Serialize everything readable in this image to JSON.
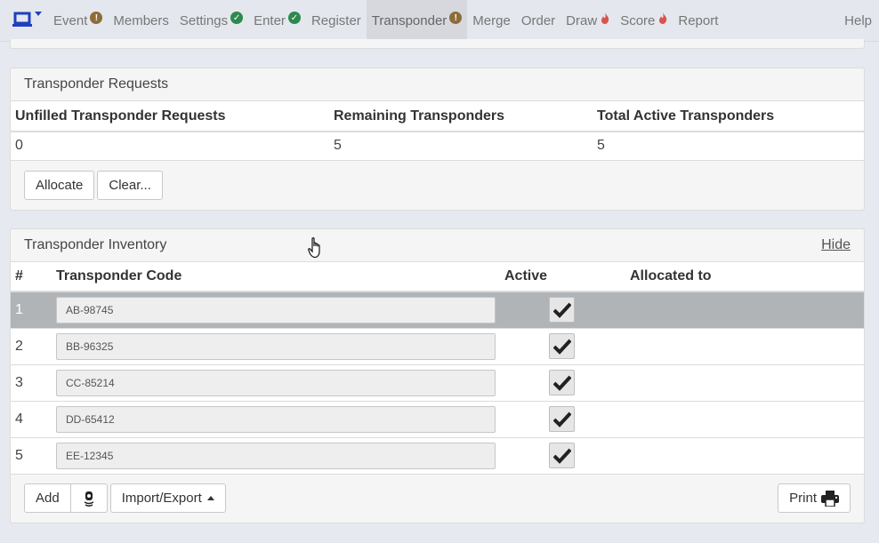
{
  "nav": {
    "brand_icon": "laptop-icon",
    "items": [
      {
        "label": "Event",
        "status": "warn"
      },
      {
        "label": "Members",
        "status": ""
      },
      {
        "label": "Settings",
        "status": "ok"
      },
      {
        "label": "Enter",
        "status": "ok"
      },
      {
        "label": "Register",
        "status": ""
      },
      {
        "label": "Transponder",
        "status": "warn",
        "active": true
      },
      {
        "label": "Merge",
        "status": ""
      },
      {
        "label": "Order",
        "status": ""
      },
      {
        "label": "Draw",
        "status": "fire"
      },
      {
        "label": "Score",
        "status": "fire"
      },
      {
        "label": "Report",
        "status": ""
      }
    ],
    "help_label": "Help",
    "colors": {
      "warn": "#8c6d3a",
      "ok": "#2d8a4e",
      "fire": "#d9534f"
    }
  },
  "requests": {
    "title": "Transponder Requests",
    "headers": [
      "Unfilled Transponder Requests",
      "Remaining Transponders",
      "Total Active Transponders"
    ],
    "values": [
      "0",
      "5",
      "5"
    ],
    "allocate_label": "Allocate",
    "clear_label": "Clear..."
  },
  "inventory": {
    "title": "Transponder Inventory",
    "hide_label": "Hide",
    "headers": {
      "num": "#",
      "code": "Transponder Code",
      "active": "Active",
      "allocated": "Allocated to"
    },
    "rows": [
      {
        "num": "1",
        "code": "AB-98745",
        "active": true,
        "allocated": ""
      },
      {
        "num": "2",
        "code": "BB-96325",
        "active": true,
        "allocated": ""
      },
      {
        "num": "3",
        "code": "CC-85214",
        "active": true,
        "allocated": ""
      },
      {
        "num": "4",
        "code": "DD-65412",
        "active": true,
        "allocated": ""
      },
      {
        "num": "5",
        "code": "EE-12345",
        "active": true,
        "allocated": ""
      }
    ],
    "add_label": "Add",
    "import_export_label": "Import/Export",
    "print_label": "Print"
  }
}
